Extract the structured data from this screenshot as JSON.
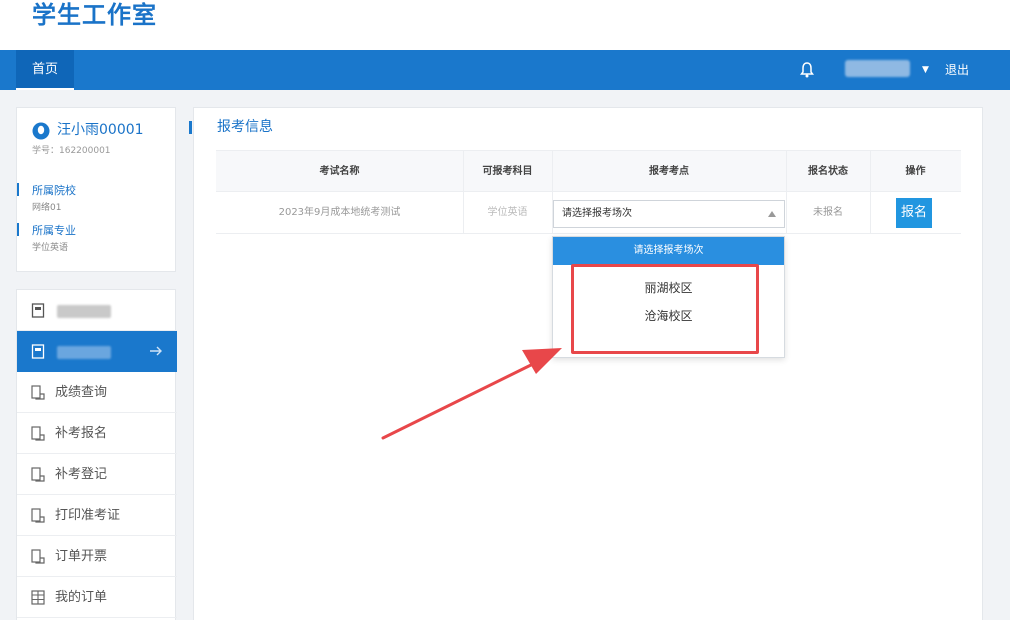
{
  "header": {
    "app_title": "学生工作室"
  },
  "navbar": {
    "home_label": "首页",
    "logout_label": "退出",
    "bell_icon": "bell-icon",
    "caret_icon": "caret-down-icon"
  },
  "profile": {
    "name": "汪小雨00001",
    "student_id": "学号：162200001",
    "fields": [
      {
        "label": "所属院校",
        "value": "网络01"
      },
      {
        "label": "所属专业",
        "value": "学位英语"
      }
    ]
  },
  "sidebar": {
    "items": [
      {
        "label": "",
        "icon": "document-icon",
        "blurred": true,
        "active": false
      },
      {
        "label": "",
        "icon": "document-icon",
        "blurred": true,
        "active": true
      },
      {
        "label": "成绩查询",
        "icon": "book-icon",
        "active": false
      },
      {
        "label": "补考报名",
        "icon": "book-icon",
        "active": false
      },
      {
        "label": "补考登记",
        "icon": "book-icon",
        "active": false
      },
      {
        "label": "打印准考证",
        "icon": "book-icon",
        "active": false
      },
      {
        "label": "订单开票",
        "icon": "book-icon",
        "active": false
      },
      {
        "label": "我的订单",
        "icon": "grid-icon",
        "active": false
      }
    ]
  },
  "section": {
    "title": "报考信息"
  },
  "table": {
    "headers": [
      "考试名称",
      "可报考科目",
      "报考考点",
      "报名状态",
      "操作"
    ],
    "row": {
      "exam_name": "2023年9月成本地统考测试",
      "subjects": "学位英语",
      "site_placeholder": "请选择报考场次",
      "status": "未报名",
      "action_label": "报名"
    }
  },
  "dropdown": {
    "header": "请选择报考场次",
    "options": [
      "丽湖校区",
      "沧海校区"
    ]
  },
  "colors": {
    "primary": "#1a78cc",
    "highlight": "#e8474a"
  }
}
